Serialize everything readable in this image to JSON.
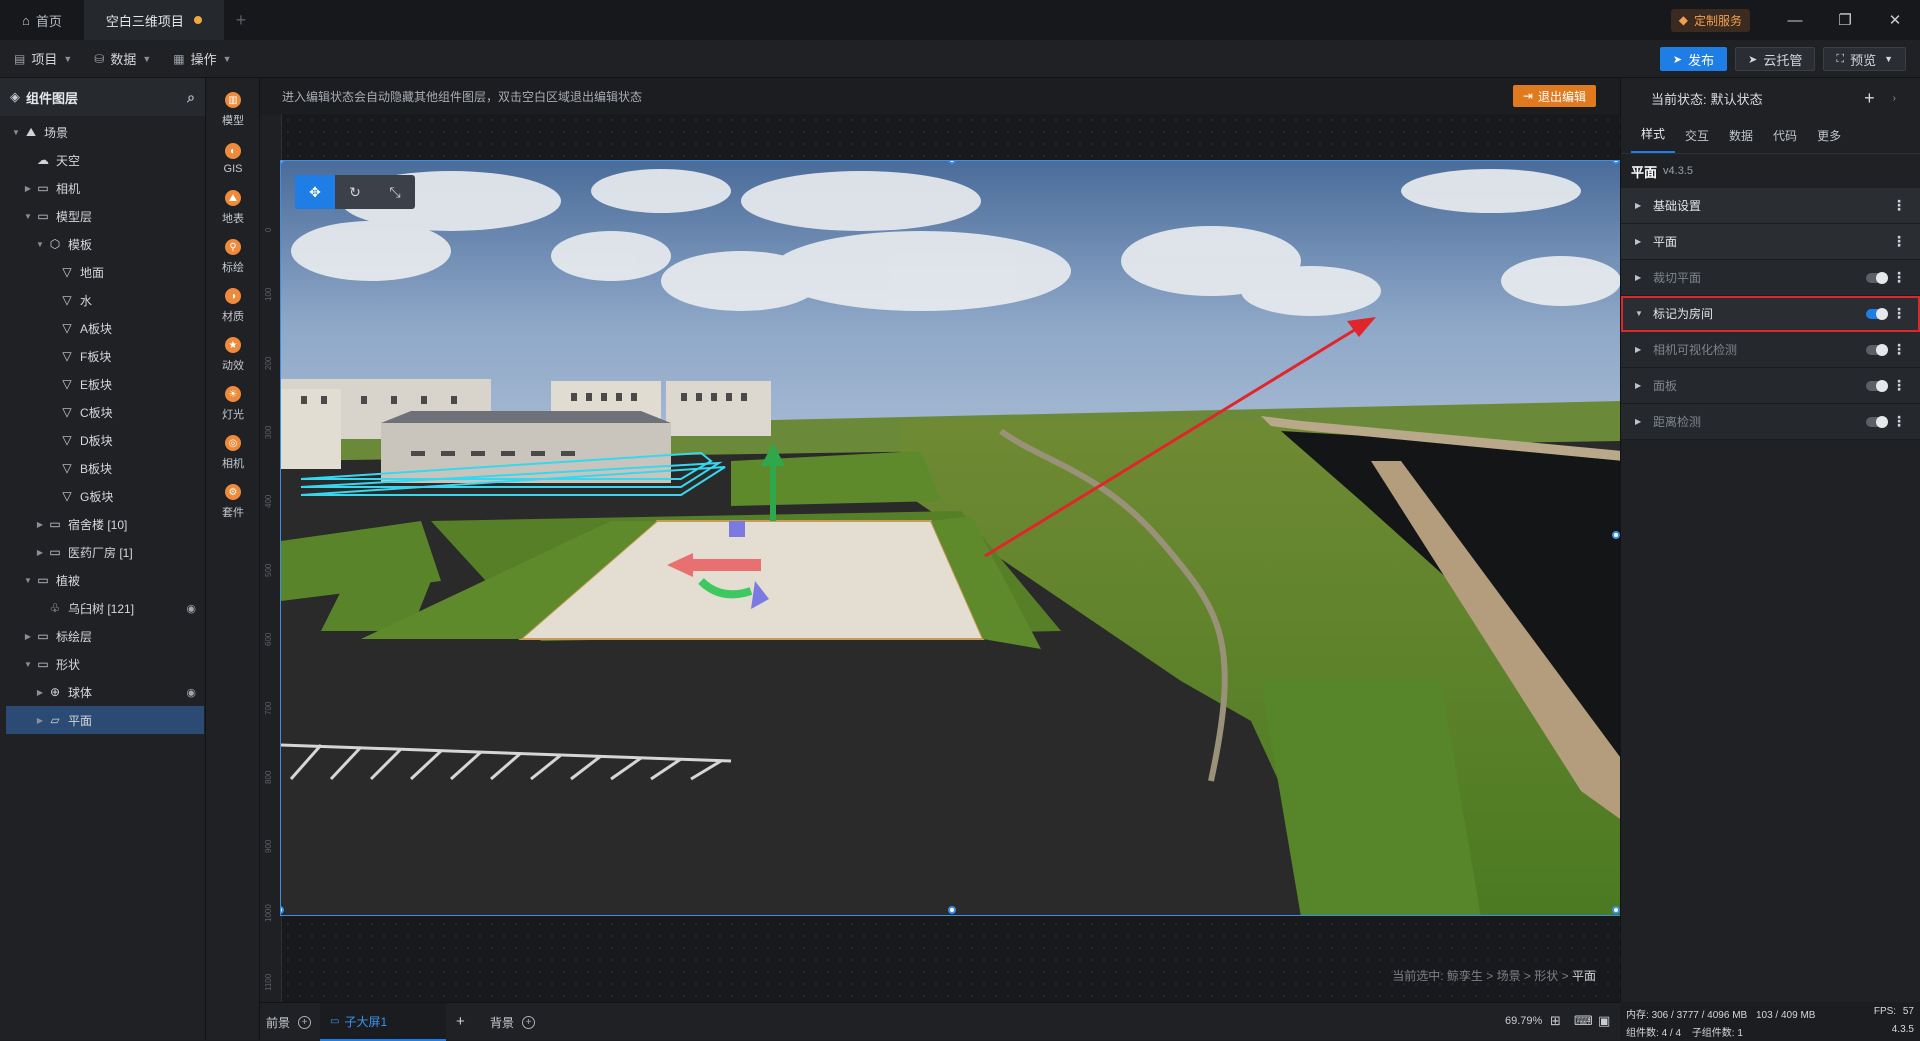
{
  "titlebar": {
    "tabs": [
      {
        "label": "首页",
        "icon": "home-icon"
      },
      {
        "label": "空白三维项目",
        "modified": true
      }
    ],
    "custom_service": "定制服务",
    "window_buttons": [
      "minimize",
      "restore",
      "close"
    ]
  },
  "menubar": {
    "items": [
      {
        "label": "项目",
        "icon": "document-icon"
      },
      {
        "label": "数据",
        "icon": "database-icon"
      },
      {
        "label": "操作",
        "icon": "grid-icon"
      }
    ],
    "publish": "发布",
    "cloud_host": "云托管",
    "preview": "预览"
  },
  "layers": {
    "title": "组件图层",
    "items": [
      {
        "label": "场景",
        "depth": 0,
        "expanded": true,
        "icon": "scene-icon"
      },
      {
        "label": "天空",
        "depth": 1,
        "icon": "cloud-icon"
      },
      {
        "label": "相机",
        "depth": 1,
        "expanded": false,
        "icon": "folder-icon"
      },
      {
        "label": "模型层",
        "depth": 1,
        "expanded": true,
        "icon": "folder-icon"
      },
      {
        "label": "模板",
        "depth": 2,
        "expanded": true,
        "icon": "cube-icon"
      },
      {
        "label": "地面",
        "depth": 3,
        "icon": "mesh-icon"
      },
      {
        "label": "水",
        "depth": 3,
        "icon": "mesh-icon"
      },
      {
        "label": "A板块",
        "depth": 3,
        "icon": "mesh-icon"
      },
      {
        "label": "F板块",
        "depth": 3,
        "icon": "mesh-icon"
      },
      {
        "label": "E板块",
        "depth": 3,
        "icon": "mesh-icon"
      },
      {
        "label": "C板块",
        "depth": 3,
        "icon": "mesh-icon"
      },
      {
        "label": "D板块",
        "depth": 3,
        "icon": "mesh-icon"
      },
      {
        "label": "B板块",
        "depth": 3,
        "icon": "mesh-icon"
      },
      {
        "label": "G板块",
        "depth": 3,
        "icon": "mesh-icon"
      },
      {
        "label": "宿舍楼 [10]",
        "depth": 2,
        "expanded": false,
        "icon": "folder-icon"
      },
      {
        "label": "医药厂房 [1]",
        "depth": 2,
        "expanded": false,
        "icon": "folder-icon"
      },
      {
        "label": "植被",
        "depth": 1,
        "expanded": true,
        "icon": "folder-icon"
      },
      {
        "label": "乌臼树 [121]",
        "depth": 2,
        "icon": "tree-icon",
        "hidden": true
      },
      {
        "label": "标绘层",
        "depth": 1,
        "expanded": false,
        "icon": "folder-icon"
      },
      {
        "label": "形状",
        "depth": 1,
        "expanded": true,
        "icon": "folder-icon"
      },
      {
        "label": "球体",
        "depth": 2,
        "expanded": false,
        "icon": "globe-icon",
        "hidden": true
      },
      {
        "label": "平面",
        "depth": 2,
        "expanded": false,
        "icon": "plane-icon",
        "selected": true
      }
    ]
  },
  "tools": [
    {
      "label": "模型",
      "icon": "model-icon"
    },
    {
      "label": "GIS",
      "icon": "gis-icon"
    },
    {
      "label": "地表",
      "icon": "terrain-icon"
    },
    {
      "label": "标绘",
      "icon": "marker-icon"
    },
    {
      "label": "材质",
      "icon": "material-icon"
    },
    {
      "label": "动效",
      "icon": "effect-icon"
    },
    {
      "label": "灯光",
      "icon": "light-icon"
    },
    {
      "label": "相机",
      "icon": "camera-icon"
    },
    {
      "label": "套件",
      "icon": "kit-icon"
    }
  ],
  "canvas": {
    "notice": "进入编辑状态会自动隐藏其他组件图层，双击空白区域退出编辑状态",
    "exit_edit": "退出编辑",
    "ruler_left": [
      "0",
      "100",
      "200",
      "300",
      "400",
      "500",
      "600",
      "700",
      "800",
      "900",
      "1000",
      "1100"
    ],
    "breadcrumb_prefix": "当前选中:",
    "breadcrumb": [
      "鲸孪生",
      "场景",
      "形状"
    ],
    "breadcrumb_last": "平面",
    "gizmo_tools": [
      "move-icon",
      "rotate-icon",
      "scale-icon"
    ]
  },
  "bottombar": {
    "foreground": "前景",
    "screen_tab": "子大屏1",
    "background": "背景",
    "zoom": "69.79%"
  },
  "props": {
    "state_label": "当前状态:",
    "state_value": "默认状态",
    "tabs": [
      "样式",
      "交互",
      "数据",
      "代码",
      "更多"
    ],
    "active_tab": "样式",
    "component_name": "平面",
    "component_version": "v4.3.5",
    "sections": [
      {
        "label": "基础设置",
        "expanded": false,
        "dim": false,
        "toggle": null
      },
      {
        "label": "平面",
        "expanded": false,
        "dim": false,
        "toggle": null
      },
      {
        "label": "裁切平面",
        "expanded": false,
        "dim": true,
        "toggle": false
      },
      {
        "label": "标记为房间",
        "expanded": true,
        "dim": false,
        "toggle": true,
        "highlighted": true
      },
      {
        "label": "相机可视化检测",
        "expanded": false,
        "dim": true,
        "toggle": false
      },
      {
        "label": "面板",
        "expanded": false,
        "dim": true,
        "toggle": false
      },
      {
        "label": "距离检测",
        "expanded": false,
        "dim": true,
        "toggle": false
      }
    ]
  },
  "status": {
    "memory_label": "内存:",
    "memory_value": "306 / 3777 / 4096 MB",
    "gpu_value": "103 / 409 MB",
    "fps_label": "FPS:",
    "fps_value": "57",
    "components_label": "组件数:",
    "components_value": "4 / 4",
    "children_label": "子组件数:",
    "children_value": "1",
    "version": "4.3.5"
  },
  "colors": {
    "accent": "#1f7ee6",
    "warning": "#e07a1f",
    "highlight": "#e0252b"
  }
}
